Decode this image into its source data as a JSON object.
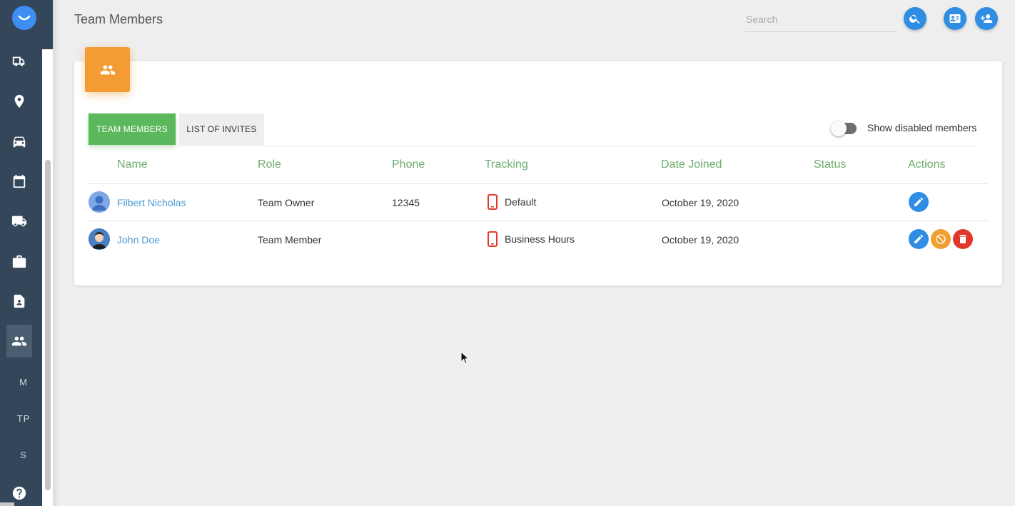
{
  "header": {
    "title": "Team Members",
    "search_placeholder": "Search"
  },
  "sidebar": {
    "items": [
      {
        "icon": "truck-fleet-icon"
      },
      {
        "icon": "location-pin-icon"
      },
      {
        "icon": "car-icon"
      },
      {
        "icon": "calendar-icon"
      },
      {
        "icon": "delivery-truck-icon"
      },
      {
        "icon": "briefcase-icon"
      },
      {
        "icon": "contact-card-icon"
      },
      {
        "icon": "people-icon",
        "active": true
      }
    ],
    "text_items": [
      "M",
      "TP",
      "S"
    ],
    "help_icon": "help-icon"
  },
  "tabs": {
    "team_members": "TEAM MEMBERS",
    "list_of_invites": "LIST OF INVITES"
  },
  "toggle": {
    "label": "Show disabled members",
    "enabled": false
  },
  "table": {
    "columns": [
      "Name",
      "Role",
      "Phone",
      "Tracking",
      "Date Joined",
      "Status",
      "Actions"
    ],
    "rows": [
      {
        "name": "Filbert Nicholas",
        "role": "Team Owner",
        "phone": "12345",
        "tracking": "Default",
        "date_joined": "October 19, 2020",
        "status": ""
      },
      {
        "name": "John Doe",
        "role": "Team Member",
        "phone": "",
        "tracking": "Business Hours",
        "date_joined": "October 19, 2020",
        "status": ""
      }
    ]
  },
  "colors": {
    "sidebar": "#33465a",
    "accent_green": "#5cb85c",
    "accent_orange": "#f39c33",
    "accent_blue": "#2f8de4",
    "danger_red": "#e0392b"
  }
}
